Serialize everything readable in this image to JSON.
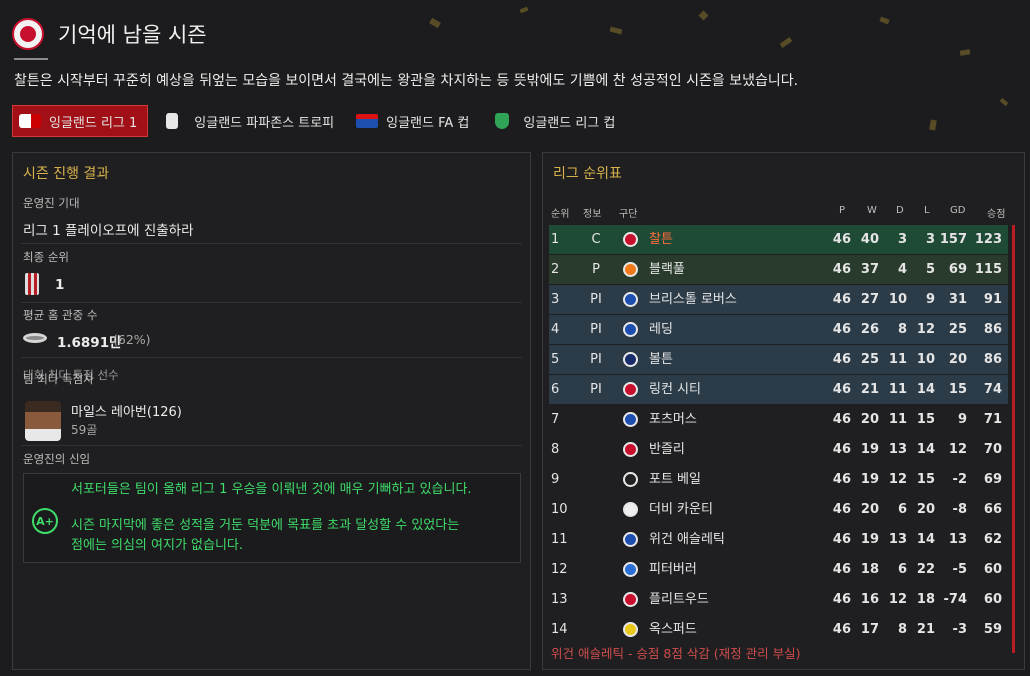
{
  "header": {
    "title": "기억에 남을 시즌",
    "intro": "찰튼은 시작부터 꾸준히 예상을 뒤엎는 모습을 보이면서 결국에는 왕관을 차지하는 등 뜻밖에도 기쁨에 찬 성공적인 시즌을 보냈습니다."
  },
  "tabs": [
    {
      "label": "잉글랜드 리그 1",
      "icon": "efl-league-icon",
      "active": true
    },
    {
      "label": "잉글랜드 파파존스 트로피",
      "icon": "trophy-icon",
      "active": false
    },
    {
      "label": "잉글랜드 FA 컵",
      "icon": "fa-cup-icon",
      "active": false
    },
    {
      "label": "잉글랜드 리그 컵",
      "icon": "carabao-cup-icon",
      "active": false
    }
  ],
  "summary": {
    "title": "시즌 진행 결과",
    "expectation_label": "운영진 기대",
    "expectation": "리그 1 플레이오프에 진출하라",
    "final_position_label": "최종 순위",
    "final_position": "1",
    "attendance_label": "평균 홈 관중 수",
    "attendance": "1.6891만",
    "attendance_pct": "(62%)",
    "top_scorer_label": "팀 최다 득점자",
    "top_scorer_label_overlap": "대회 최다 특점 선수",
    "top_scorer_name": "마일스 레아번(126)",
    "top_scorer_goals": "59골",
    "confidence_label": "운영진의 신임",
    "grade": "A+",
    "verdict_line1": "서포터들은 팀이 올해 리그 1 우승을 이뤄낸 것에 매우 기뻐하고 있습니다.",
    "verdict_line2": "시즌 마지막에 좋은 성적을 거둔 덕분에 목표를 초과 달성할 수 있었다는",
    "verdict_line3": "점에는 의심의 여지가 없습니다."
  },
  "league": {
    "title": "리그 순위표",
    "columns": {
      "pos": "순위",
      "info": "정보",
      "team": "구단",
      "p": "P",
      "w": "W",
      "d": "D",
      "l": "L",
      "gd": "GD",
      "pts": "승점"
    },
    "rows": [
      {
        "pos": "1",
        "info": "C",
        "team": "찰튼",
        "p": "46",
        "w": "40",
        "d": "3",
        "l": "3",
        "gd": "157",
        "pts": "123",
        "zone": "champ",
        "crest": "#c8102e"
      },
      {
        "pos": "2",
        "info": "P",
        "team": "블랙풀",
        "p": "46",
        "w": "37",
        "d": "4",
        "l": "5",
        "gd": "69",
        "pts": "115",
        "zone": "prom",
        "crest": "#f07a1a"
      },
      {
        "pos": "3",
        "info": "PI",
        "team": "브리스톨 로버스",
        "p": "46",
        "w": "27",
        "d": "10",
        "l": "9",
        "gd": "31",
        "pts": "91",
        "zone": "po",
        "crest": "#1d4fb0"
      },
      {
        "pos": "4",
        "info": "PI",
        "team": "레딩",
        "p": "46",
        "w": "26",
        "d": "8",
        "l": "12",
        "gd": "25",
        "pts": "86",
        "zone": "po",
        "crest": "#1d4fb0"
      },
      {
        "pos": "5",
        "info": "PI",
        "team": "볼튼",
        "p": "46",
        "w": "25",
        "d": "11",
        "l": "10",
        "gd": "20",
        "pts": "86",
        "zone": "po",
        "crest": "#1a2d6b"
      },
      {
        "pos": "6",
        "info": "PI",
        "team": "링컨 시티",
        "p": "46",
        "w": "21",
        "d": "11",
        "l": "14",
        "gd": "15",
        "pts": "74",
        "zone": "po",
        "crest": "#c8102e"
      },
      {
        "pos": "7",
        "info": "",
        "team": "포츠머스",
        "p": "46",
        "w": "20",
        "d": "11",
        "l": "15",
        "gd": "9",
        "pts": "71",
        "zone": "",
        "crest": "#1d4fb0"
      },
      {
        "pos": "8",
        "info": "",
        "team": "반즐리",
        "p": "46",
        "w": "19",
        "d": "13",
        "l": "14",
        "gd": "12",
        "pts": "70",
        "zone": "",
        "crest": "#c8102e"
      },
      {
        "pos": "9",
        "info": "",
        "team": "포트 베일",
        "p": "46",
        "w": "19",
        "d": "12",
        "l": "15",
        "gd": "-2",
        "pts": "69",
        "zone": "",
        "crest": "#222222"
      },
      {
        "pos": "10",
        "info": "",
        "team": "더비 카운티",
        "p": "46",
        "w": "20",
        "d": "6",
        "l": "20",
        "gd": "-8",
        "pts": "66",
        "zone": "",
        "crest": "#eeeeee"
      },
      {
        "pos": "11",
        "info": "",
        "team": "위건 애슬레틱",
        "p": "46",
        "w": "19",
        "d": "13",
        "l": "14",
        "gd": "13",
        "pts": "62",
        "zone": "",
        "crest": "#1d4fb0"
      },
      {
        "pos": "12",
        "info": "",
        "team": "피터버러",
        "p": "46",
        "w": "18",
        "d": "6",
        "l": "22",
        "gd": "-5",
        "pts": "60",
        "zone": "",
        "crest": "#2a6fd6"
      },
      {
        "pos": "13",
        "info": "",
        "team": "플리트우드",
        "p": "46",
        "w": "16",
        "d": "12",
        "l": "18",
        "gd": "-74",
        "pts": "60",
        "zone": "",
        "crest": "#c8102e"
      },
      {
        "pos": "14",
        "info": "",
        "team": "옥스퍼드",
        "p": "46",
        "w": "17",
        "d": "8",
        "l": "21",
        "gd": "-3",
        "pts": "59",
        "zone": "",
        "crest": "#e8c81a"
      }
    ],
    "footnote": "위건 애슬레틱 - 승점 8점 삭감 (재정 관리 부실)"
  },
  "colors": {
    "accent": "#d6b24a",
    "tab_active": "#a01016",
    "grade": "#3fdc6a",
    "champion_row": "#1f4a36",
    "promotion_row": "#293b2d",
    "playoff_row": "#2b3b48"
  }
}
